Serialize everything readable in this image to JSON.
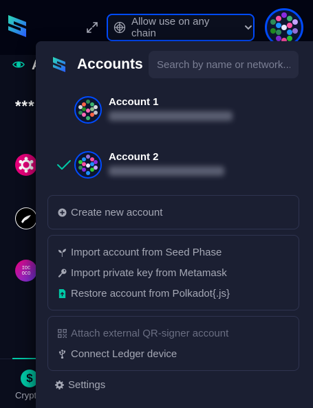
{
  "app": {
    "chain_selector_label": "Allow use on any chain",
    "background_heading_partial": "A",
    "background_balance_masked": "***",
    "background_footer_label_partial": "Crypt",
    "background_footer_icon": "$"
  },
  "accounts_popover": {
    "title": "Accounts",
    "search_placeholder": "Search by name or network...",
    "accounts": [
      {
        "name": "Account 1",
        "selected": false
      },
      {
        "name": "Account 2",
        "selected": true
      }
    ],
    "actions": {
      "create_new_account": "Create new account",
      "import_seed_phrase": "Import account from Seed Phase",
      "import_metamask": "Import private key from Metamask",
      "restore_polkadot": "Restore account from Polkadot{.js}",
      "attach_qr_signer": "Attach external QR-signer account",
      "connect_ledger": "Connect Ledger device",
      "settings": "Settings"
    }
  },
  "colors": {
    "background": "#020412",
    "popover_bg": "#1b1f32",
    "accent_blue": "#004bff",
    "accent_green": "#00c9a7",
    "muted_text": "#a5a8b5",
    "disabled_text": "#6a6e82"
  },
  "icons": [
    "subwallet-logo-icon",
    "expand-icon",
    "globe-icon",
    "chevron-down-icon",
    "eye-icon",
    "checkmark-icon",
    "plus-circle-icon",
    "seedling-icon",
    "key-icon",
    "file-upload-icon",
    "qr-code-icon",
    "usb-icon",
    "gear-icon"
  ]
}
